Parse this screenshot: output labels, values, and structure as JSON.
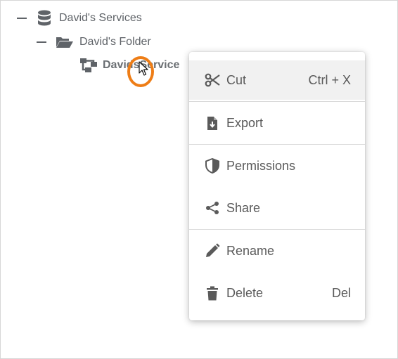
{
  "tree": {
    "root": {
      "label": "David's Services",
      "icon": "database-icon"
    },
    "folder": {
      "label": "David's Folder",
      "icon": "folder-open-icon"
    },
    "service": {
      "label": "DavidsService",
      "icon": "sitemap-icon"
    }
  },
  "context_menu": {
    "items": [
      {
        "label": "Cut",
        "shortcut": "Ctrl + X",
        "icon": "scissors-icon"
      },
      {
        "label": "Export",
        "shortcut": "",
        "icon": "file-export-icon"
      },
      {
        "label": "Permissions",
        "shortcut": "",
        "icon": "shield-icon"
      },
      {
        "label": "Share",
        "shortcut": "",
        "icon": "share-icon"
      },
      {
        "label": "Rename",
        "shortcut": "",
        "icon": "pencil-icon"
      },
      {
        "label": "Delete",
        "shortcut": "Del",
        "icon": "trash-icon"
      }
    ]
  },
  "colors": {
    "highlight_ring": "#ee7d16",
    "icon_gray": "#5f6368",
    "menu_text": "#5a5a5a",
    "hover_bg": "#f1f1f1"
  }
}
